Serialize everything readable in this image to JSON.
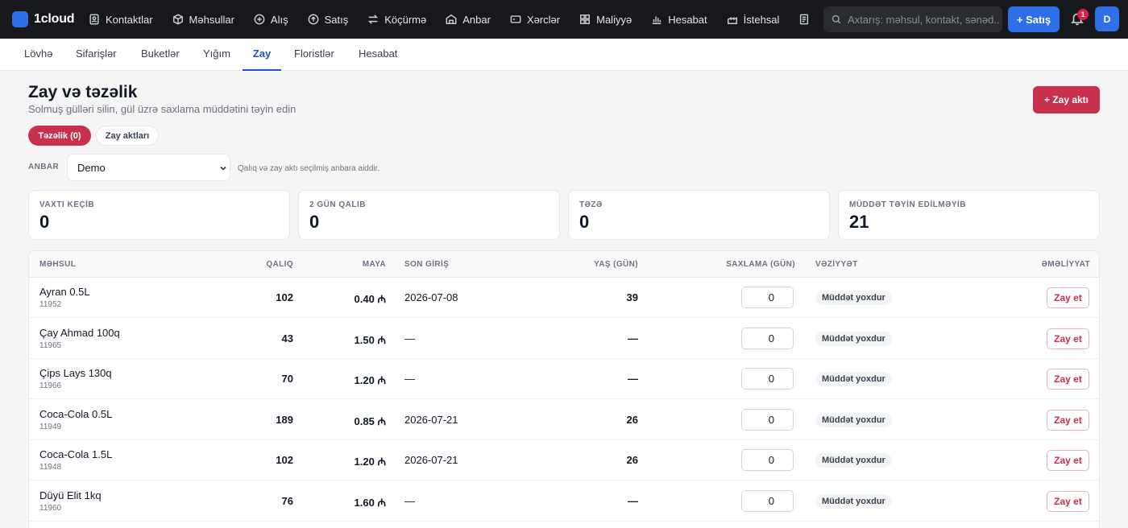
{
  "app": {
    "name": "1cloud"
  },
  "nav": {
    "items": [
      {
        "label": "Kontaktlar",
        "icon": "contacts-icon"
      },
      {
        "label": "Məhsullar",
        "icon": "box-icon"
      },
      {
        "label": "Alış",
        "icon": "plus-circle-icon"
      },
      {
        "label": "Satış",
        "icon": "sale-icon"
      },
      {
        "label": "Köçürmə",
        "icon": "transfer-icon"
      },
      {
        "label": "Anbar",
        "icon": "warehouse-icon"
      },
      {
        "label": "Xərclər",
        "icon": "wallet-icon"
      },
      {
        "label": "Maliyyə",
        "icon": "grid-icon"
      },
      {
        "label": "Hesabat",
        "icon": "bar-chart-icon"
      },
      {
        "label": "İstehsal",
        "icon": "factory-icon"
      }
    ],
    "search_placeholder": "Axtarış: məhsul, kontakt, sənəd...",
    "sale_button": "+ Satış",
    "notifications": "1",
    "avatar": "D"
  },
  "tabs": [
    "Lövhə",
    "Sifarişlər",
    "Buketlər",
    "Yığım",
    "Zay",
    "Floristlər",
    "Hesabat"
  ],
  "header": {
    "title": "Zay və təzəlik",
    "subtitle": "Solmuş gülləri silin, gül üzrə saxlama müddətini təyin edin",
    "write_off_button": "+ Zay aktı"
  },
  "filters": {
    "freshness_tab": "Təzəlik (0)",
    "acts_tab": "Zay aktları",
    "warehouse_label": "ANBAR",
    "warehouse_value": "Demo",
    "warehouse_note": "Qalıq və zay aktı seçilmiş anbara aiddir."
  },
  "stats": [
    {
      "label": "VAXTI KEÇİB",
      "value": "0"
    },
    {
      "label": "2 GÜN QALIB",
      "value": "0"
    },
    {
      "label": "TƏZƏ",
      "value": "0"
    },
    {
      "label": "MÜDDƏT TƏYİN EDİLMƏYİB",
      "value": "21"
    }
  ],
  "table": {
    "headers": {
      "product": "MƏHSUL",
      "stock": "QALIQ",
      "cost": "MAYA",
      "last": "SON GİRİŞ",
      "age": "YAŞ (GÜN)",
      "shelf": "SAXLAMA (GÜN)",
      "status": "VƏZİYYƏT",
      "actions": "ƏMƏLİYYAT"
    },
    "rows": [
      {
        "name": "Ayran 0.5L",
        "code": "11952",
        "stock": "102",
        "cost": "0.40 ₼",
        "last": "2026-07-08",
        "age": "39",
        "shelf": "0",
        "status": "Müddət yoxdur",
        "action": "Zay et"
      },
      {
        "name": "Çay Ahmad 100q",
        "code": "11965",
        "stock": "43",
        "cost": "1.50 ₼",
        "last": "—",
        "age": "—",
        "shelf": "0",
        "status": "Müddət yoxdur",
        "action": "Zay et"
      },
      {
        "name": "Çips Lays 130q",
        "code": "11966",
        "stock": "70",
        "cost": "1.20 ₼",
        "last": "—",
        "age": "—",
        "shelf": "0",
        "status": "Müddət yoxdur",
        "action": "Zay et"
      },
      {
        "name": "Coca-Cola 0.5L",
        "code": "11949",
        "stock": "189",
        "cost": "0.85 ₼",
        "last": "2026-07-21",
        "age": "26",
        "shelf": "0",
        "status": "Müddət yoxdur",
        "action": "Zay et"
      },
      {
        "name": "Coca-Cola 1.5L",
        "code": "11948",
        "stock": "102",
        "cost": "1.20 ₼",
        "last": "2026-07-21",
        "age": "26",
        "shelf": "0",
        "status": "Müddət yoxdur",
        "action": "Zay et"
      },
      {
        "name": "Düyü Elit 1kq",
        "code": "11960",
        "stock": "76",
        "cost": "1.60 ₼",
        "last": "—",
        "age": "—",
        "shelf": "0",
        "status": "Müddət yoxdur",
        "action": "Zay et"
      }
    ]
  }
}
